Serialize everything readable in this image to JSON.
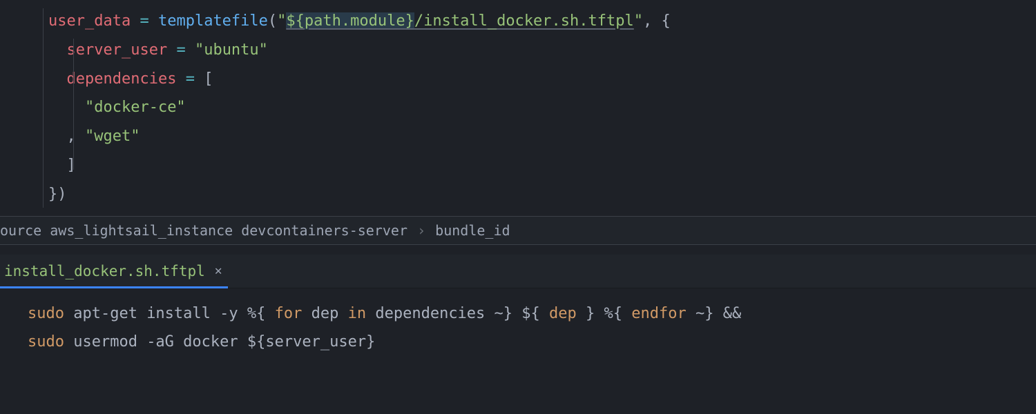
{
  "upper_editor": {
    "line1": {
      "attr": "user_data",
      "op": " = ",
      "func": "templatefile",
      "open": "(",
      "q1": "\"",
      "interp_open": "${",
      "interp_inner": "path.module",
      "interp_close": "}",
      "str_rest": "/install_docker.sh.tftpl",
      "q2": "\"",
      "comma": ", {"
    },
    "line2": {
      "attr": "server_user",
      "op": " = ",
      "str": "\"ubuntu\""
    },
    "line3": {
      "attr": "dependencies",
      "op": " = ",
      "bracket": "["
    },
    "line4": {
      "str": "\"docker-ce\""
    },
    "line5": {
      "comma": ", ",
      "str": "\"wget\""
    },
    "line6": {
      "bracket": "]"
    },
    "line7": {
      "close": "})"
    }
  },
  "breadcrumb": {
    "seg1": "ource aws_lightsail_instance devcontainers-server",
    "sep": "›",
    "seg2": "bundle_id"
  },
  "tab": {
    "label": "install_docker.sh.tftpl",
    "close_icon": "✕"
  },
  "lower_editor": {
    "line1": {
      "t1": "sudo",
      "t2": " apt-get install -y ",
      "t3": "%{",
      "t4": " for",
      "t5": " dep ",
      "t6": "in",
      "t7": " dependencies ",
      "t8": "~}",
      "t9": " ${",
      "t10": " dep ",
      "t11": "}",
      "t12": " %{",
      "t13": " endfor ",
      "t14": "~}",
      "t15": " &&"
    },
    "line2": {
      "t1": "sudo",
      "t2": " usermod -aG docker ",
      "t3": "${server_user}"
    }
  }
}
